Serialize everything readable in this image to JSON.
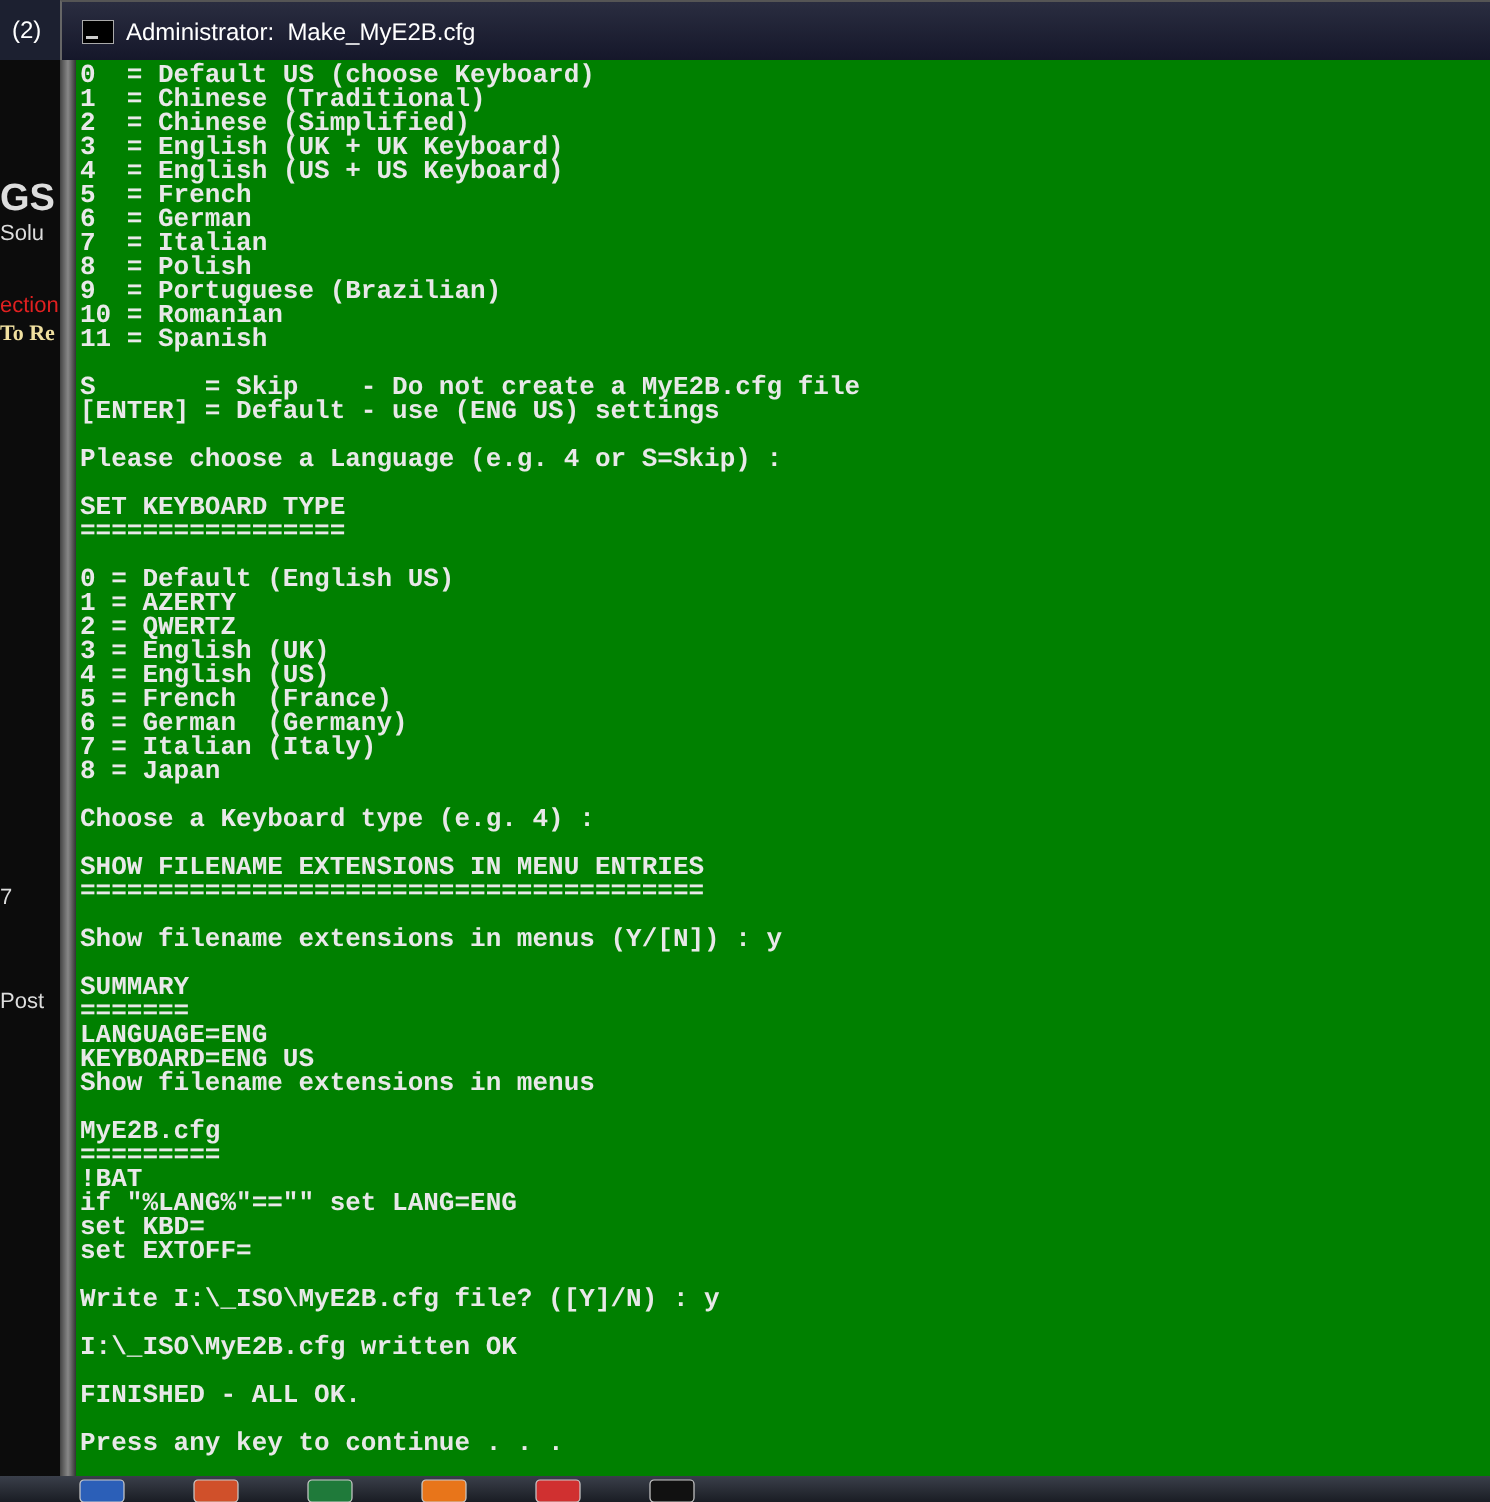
{
  "background_page": {
    "tab_title": "(2)",
    "fragments": [
      {
        "kind": "logo",
        "text": "GS"
      },
      {
        "kind": "tagline",
        "text": "Solu"
      },
      {
        "kind": "alert",
        "text": "ection"
      },
      {
        "kind": "heading",
        "text": "To Re"
      },
      {
        "kind": "count",
        "text": "7"
      },
      {
        "kind": "label",
        "text": "Post"
      }
    ]
  },
  "window": {
    "title": "Administrator:  Make_MyE2B.cfg"
  },
  "console": {
    "blocks": [
      [
        "0  = Default US (choose Keyboard)",
        "1  = Chinese (Traditional)",
        "2  = Chinese (Simplified)",
        "3  = English (UK + UK Keyboard)",
        "4  = English (US + US Keyboard)",
        "5  = French",
        "6  = German",
        "7  = Italian",
        "8  = Polish",
        "9  = Portuguese (Brazilian)",
        "10 = Romanian",
        "11 = Spanish"
      ],
      [
        "S       = Skip    - Do not create a MyE2B.cfg file",
        "[ENTER] = Default - use (ENG US) settings"
      ],
      [
        "Please choose a Language (e.g. 4 or S=Skip) :"
      ],
      [
        "SET KEYBOARD TYPE",
        "================="
      ],
      [
        "0 = Default (English US)",
        "1 = AZERTY",
        "2 = QWERTZ",
        "3 = English (UK)",
        "4 = English (US)",
        "5 = French  (France)",
        "6 = German  (Germany)",
        "7 = Italian (Italy)",
        "8 = Japan"
      ],
      [
        "Choose a Keyboard type (e.g. 4) :"
      ],
      [
        "SHOW FILENAME EXTENSIONS IN MENU ENTRIES",
        "========================================"
      ],
      [
        "Show filename extensions in menus (Y/[N]) : y"
      ],
      [
        "SUMMARY",
        "=======",
        "LANGUAGE=ENG",
        "KEYBOARD=ENG US",
        "Show filename extensions in menus"
      ],
      [
        "MyE2B.cfg",
        "=========",
        "!BAT",
        "if \"%LANG%\"==\"\" set LANG=ENG",
        "set KBD=",
        "set EXTOFF="
      ],
      [
        "Write I:\\_ISO\\MyE2B.cfg file? ([Y]/N) : y"
      ],
      [
        "I:\\_ISO\\MyE2B.cfg written OK"
      ],
      [
        "FINISHED - ALL OK."
      ],
      [
        "Press any key to continue . . ."
      ]
    ]
  },
  "taskbar": {
    "apps": [
      {
        "kind": "word"
      },
      {
        "kind": "powerpoint"
      },
      {
        "kind": "excel"
      },
      {
        "kind": "firefox"
      },
      {
        "kind": "snipping"
      },
      {
        "kind": "console"
      }
    ]
  }
}
